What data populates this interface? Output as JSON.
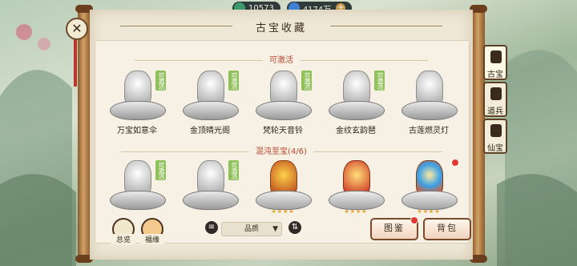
{
  "resources": [
    {
      "name": "jade-currency",
      "value": "10573",
      "color": "#3a9a6a"
    },
    {
      "name": "blue-gem",
      "value": "4174万",
      "color": "#3f7fd6"
    }
  ],
  "title": "古宝收藏",
  "sections": [
    {
      "heading": "可激活",
      "items": [
        {
          "name": "万宝如意伞",
          "badge": "可激活"
        },
        {
          "name": "金顶晴光阁",
          "badge": "可激活"
        },
        {
          "name": "梵轮天音铃",
          "badge": "可激活"
        },
        {
          "name": "金纹玄韵琶",
          "badge": "可激活"
        },
        {
          "name": "古莲燃灵灯",
          "badge": ""
        }
      ]
    },
    {
      "heading": "混沌至宝(4/6)",
      "items": [
        {
          "name": "",
          "badge": "可激活"
        },
        {
          "name": "",
          "badge": "可激活"
        },
        {
          "name": "",
          "badge": "",
          "stars": "★★★★"
        },
        {
          "name": "",
          "badge": "",
          "stars": "★★★★"
        },
        {
          "name": "",
          "badge": "",
          "stars": "★★★★",
          "red_dot": true
        }
      ]
    }
  ],
  "tabs": [
    "古宝",
    "道兵",
    "仙宝"
  ],
  "bottom": {
    "left_buttons": [
      "总览",
      "福缘"
    ],
    "sort_select": "品质",
    "btn_illustrated": "图鉴",
    "btn_backpack": "背包"
  }
}
